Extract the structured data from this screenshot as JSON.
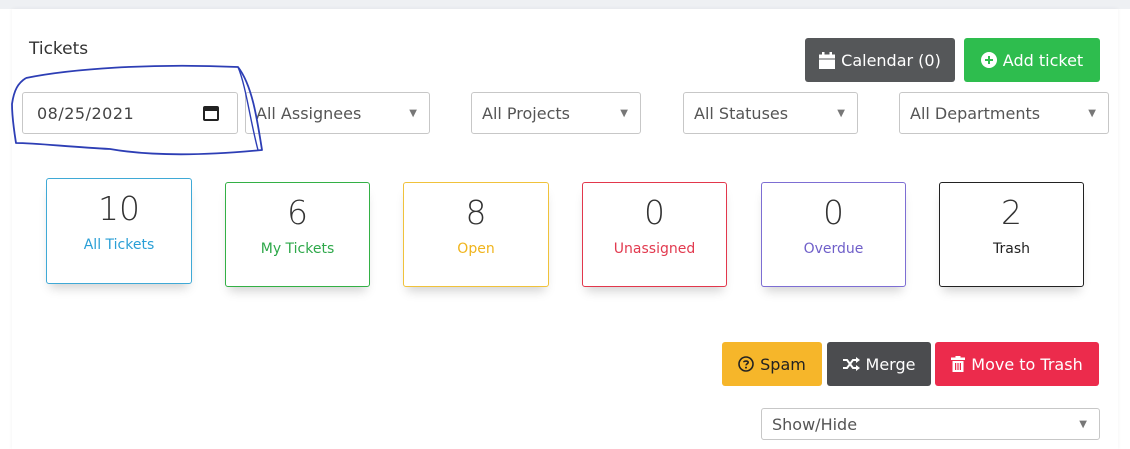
{
  "header": {
    "title": "Tickets"
  },
  "toolbar": {
    "calendar_label": "Calendar (0)",
    "add_ticket_label": "Add ticket"
  },
  "filters": {
    "date_value": "08/25/2021",
    "assignees": "All Assignees",
    "projects": "All Projects",
    "statuses": "All Statuses",
    "departments": "All Departments"
  },
  "stats": [
    {
      "count": "10",
      "label": "All Tickets"
    },
    {
      "count": "6",
      "label": "My Tickets"
    },
    {
      "count": "8",
      "label": "Open"
    },
    {
      "count": "0",
      "label": "Unassigned"
    },
    {
      "count": "0",
      "label": "Overdue"
    },
    {
      "count": "2",
      "label": "Trash"
    }
  ],
  "actions": {
    "spam_label": "Spam",
    "merge_label": "Merge",
    "trash_label": "Move to Trash"
  },
  "columns": {
    "showhide": "Show/Hide"
  },
  "colors": {
    "calendar": "#555759",
    "add": "#2ebd4e",
    "spam": "#f6b62a",
    "merge": "#4b4c4f",
    "trash": "#ec2b4c",
    "annotation": "#2d3eb5"
  }
}
